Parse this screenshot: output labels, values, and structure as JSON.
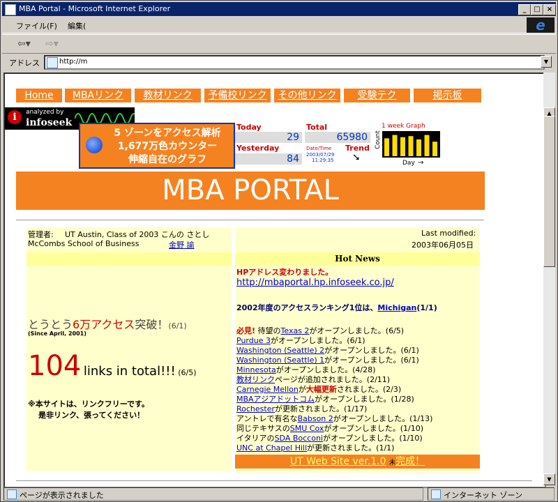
{
  "window": {
    "title": "MBA Portal - Microsoft Internet Explorer",
    "min": "_",
    "max": "□",
    "close": "×"
  },
  "menu": {
    "file": "ファイル(F)",
    "edit": "編集("
  },
  "address": {
    "label": "アドレス",
    "url": "http://m"
  },
  "status": {
    "main": "ページが表示されました",
    "zone": "インターネット ゾーン"
  },
  "nav": [
    "Home",
    "MBAリンク",
    "教材リンク",
    "予備校リンク",
    "その他リンク",
    "受験テク",
    "掲示板"
  ],
  "infoseek": {
    "analyzed": "analyzed by",
    "brand": "infoseek"
  },
  "promo": [
    "5 ゾーンをアクセス解析",
    "1,677万色カウンター",
    "伸縮自在のグラフ"
  ],
  "stats": {
    "today_label": "Today",
    "today": "29",
    "total_label": "Total",
    "total": "65980",
    "yesterday_label": "Yesterday",
    "yesterday": "84",
    "datetime_label": "Date/Time",
    "date": "2003/07/29",
    "time": "11:29:35",
    "trend_label": "Trend"
  },
  "graph": {
    "title": "1 week Graph",
    "ylabel": "Count",
    "xlabel": "Day",
    "values": [
      0.8,
      0.95,
      0.85,
      0.9,
      0.75,
      0.95,
      0.65
    ]
  },
  "site_title": "MBA PORTAL",
  "admin": {
    "label": "管理者:",
    "line1": "UT Austin, Class of 2003 こんの さとし",
    "line2": "McCombs School of Business",
    "name_link": "金野 諭"
  },
  "modified": {
    "label": "Last modified:",
    "date": "2003年06月05日"
  },
  "hot_news_title": "Hot News",
  "left": {
    "access_pre": "とうとう",
    "access_num": "6万アクセス",
    "access_post": "突破！",
    "access_date": "(6/1)",
    "since": "(Since April, 2001)",
    "links_num": "104",
    "links_text": "links in total!!!",
    "links_date": "(6/5)",
    "note1": "※本サイトは、リンクフリーです。",
    "note2": "是非リンク、張ってください！"
  },
  "news": {
    "hp_changed": "HPアドレス変わりました。",
    "hp_url": "http://mbaportal.hp.infoseek.co.jp/",
    "ranking_pre": "2002年度のアクセスランキング1位は、",
    "ranking_link": "Michigan",
    "ranking_post": "(1/1)",
    "must": "必見!",
    "items": [
      {
        "pre": "待望の",
        "link": "Texas 2",
        "post": "がオープンしました。(6/5)"
      },
      {
        "pre": "",
        "link": "Purdue 3",
        "post": "がオープンしました。(6/1)"
      },
      {
        "pre": "",
        "link": "Washington (Seattle) 2",
        "post": "がオープンしました。(6/1)"
      },
      {
        "pre": "",
        "link": "Washington (Seattle) 1",
        "post": "がオープンしました。(6/1)"
      },
      {
        "pre": "",
        "link": "Minnesota",
        "post": "がオープンしました。(4/28)"
      },
      {
        "pre": "",
        "link": "教材リンク",
        "post": "ページが追加されました。(2/11)"
      },
      {
        "pre": "",
        "link": "Carnegie Mellon",
        "post_red": "大幅更新",
        "post_mid": "が",
        "post": "されました。(2/3)"
      },
      {
        "pre": "",
        "link": "MBAアジアドットコム",
        "post": "がオープンしました。(1/28)"
      },
      {
        "pre": "",
        "link": "Rochester",
        "post": "が更新されました。(1/17)"
      },
      {
        "pre": "アントレで有名な",
        "link": "Babson 2",
        "post": "がオープンしました。(1/13)"
      },
      {
        "pre": "同じテキサスの",
        "link": "SMU Cox",
        "post": "がオープンしました。(1/10)"
      },
      {
        "pre": "イタリアの",
        "link": "SDA Bocconi",
        "post": "がオープンしました。(1/10)"
      },
      {
        "pre": "",
        "link": "UNC at Chapel Hill",
        "post": "が更新されました。(1/1)"
      }
    ]
  },
  "ut_bar": {
    "text": "UT Web Site ver.1.0",
    "small": "未",
    "done": "完成！"
  }
}
